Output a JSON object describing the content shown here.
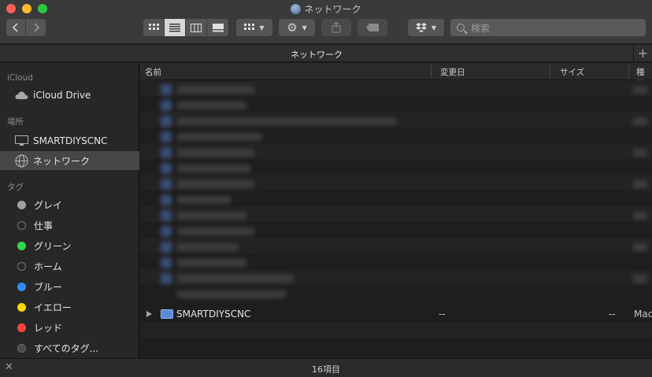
{
  "window": {
    "title": "ネットワーク"
  },
  "toolbar": {
    "back_icon": "chevron-left-icon",
    "forward_icon": "chevron-right-icon",
    "view_modes": [
      "icon-view",
      "list-view",
      "column-view",
      "gallery-view"
    ],
    "active_view": "list-view",
    "search_placeholder": "検索"
  },
  "tab": {
    "title": "ネットワーク",
    "add_label": "+"
  },
  "sidebar": {
    "sections": [
      {
        "heading": "iCloud",
        "items": [
          {
            "label": "iCloud Drive",
            "icon": "cloud-icon"
          }
        ]
      },
      {
        "heading": "場所",
        "items": [
          {
            "label": "SMARTDIYSCNC",
            "icon": "display-icon"
          },
          {
            "label": "ネットワーク",
            "icon": "network-globe-icon",
            "selected": true
          }
        ]
      },
      {
        "heading": "タグ",
        "items": [
          {
            "label": "グレイ",
            "color": "#a0a0a0"
          },
          {
            "label": "仕事",
            "color": "hollow"
          },
          {
            "label": "グリーン",
            "color": "#32d74b"
          },
          {
            "label": "ホーム",
            "color": "hollow"
          },
          {
            "label": "ブルー",
            "color": "#2f8cff"
          },
          {
            "label": "イエロー",
            "color": "#ffd60a"
          },
          {
            "label": "レッド",
            "color": "#ff453a"
          },
          {
            "label": "すべてのタグ...",
            "color": "hollow-gray"
          }
        ]
      }
    ]
  },
  "columns": {
    "name": "名前",
    "date": "変更日",
    "size": "サイズ",
    "kind": "種類"
  },
  "rows": [
    {
      "name": "SMARTDIYSCNC",
      "date": "--",
      "size": "--",
      "kind": "Mac"
    }
  ],
  "status": {
    "item_count": "16項目"
  }
}
